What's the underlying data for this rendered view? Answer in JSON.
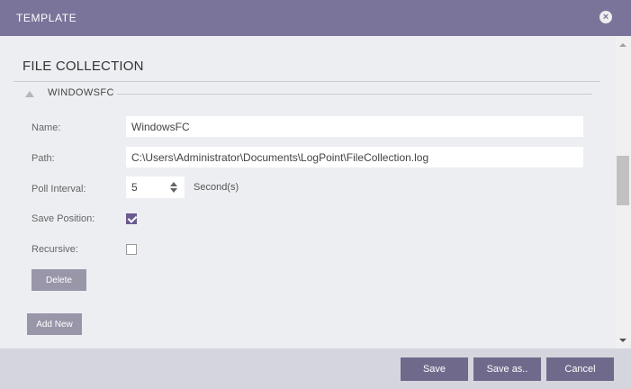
{
  "dialog": {
    "title": "TEMPLATE",
    "close_icon": "close-icon"
  },
  "section": {
    "title": "FILE COLLECTION"
  },
  "group": {
    "title": "WINDOWSFC",
    "collapse_icon": "triangle-up-icon"
  },
  "form": {
    "name_label": "Name:",
    "name_value": "WindowsFC",
    "path_label": "Path:",
    "path_value": "C:\\Users\\Administrator\\Documents\\LogPoint\\FileCollection.log",
    "poll_label": "Poll Interval:",
    "poll_value": "5",
    "poll_unit": "Second(s)",
    "save_position_label": "Save Position:",
    "save_position_checked": true,
    "recursive_label": "Recursive:",
    "recursive_checked": false,
    "delete_label": "Delete",
    "add_new_label": "Add New"
  },
  "footer": {
    "save_label": "Save",
    "save_as_label": "Save as..",
    "cancel_label": "Cancel"
  },
  "colors": {
    "titlebar": "#7a749a",
    "accent": "#6b5a8e",
    "primary_button": "#6f6a8c",
    "secondary_button": "#9896a8"
  }
}
